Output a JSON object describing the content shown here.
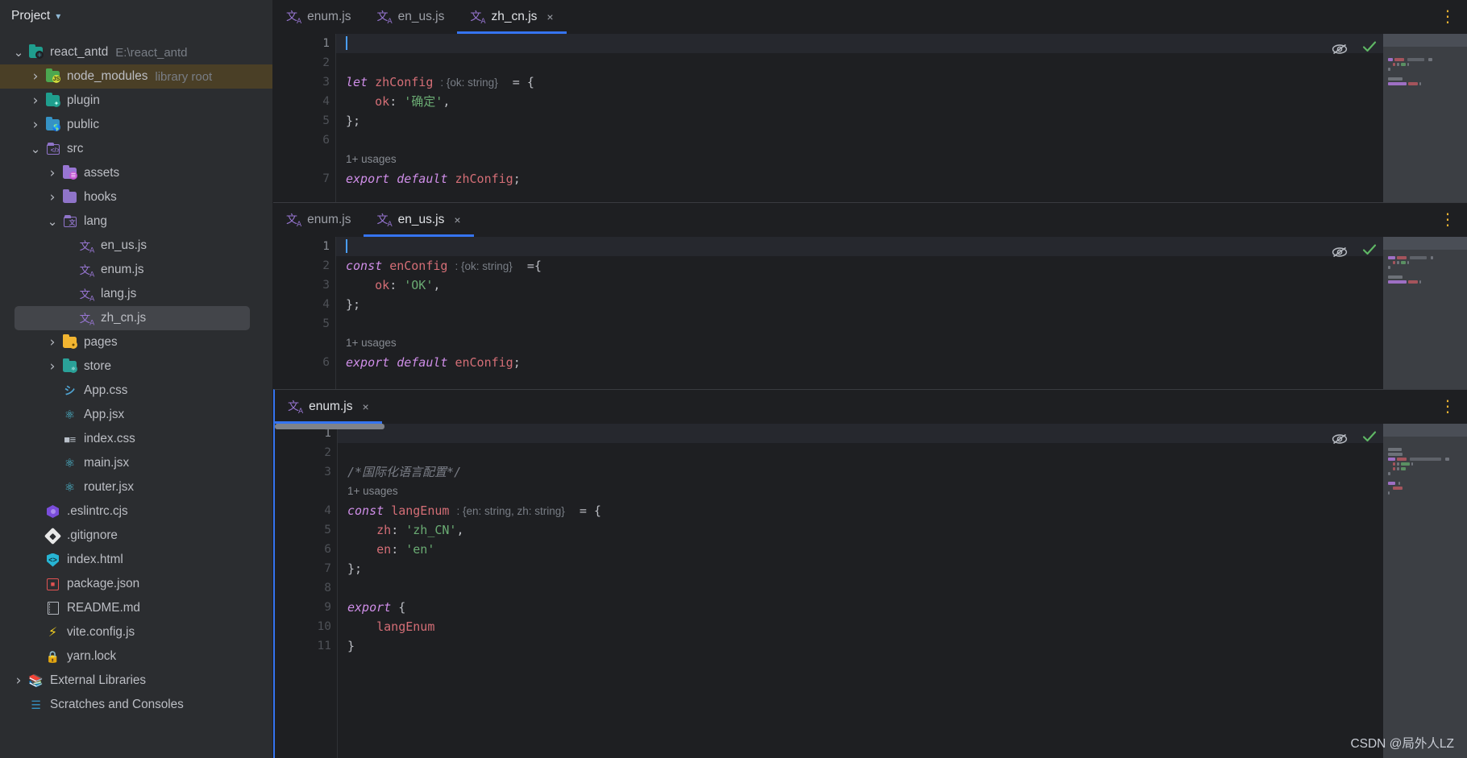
{
  "sidebar": {
    "title": "Project",
    "title_chevron": "chevron-down-icon",
    "tree": [
      {
        "label": "react_antd",
        "hint": "E:\\react_antd",
        "arrow": "v",
        "icon": "module-icon",
        "depth": 0,
        "state": "normal"
      },
      {
        "label": "node_modules",
        "hint": "library root",
        "arrow": ">",
        "icon": "folder-node-icon",
        "depth": 1,
        "state": "library-highlight"
      },
      {
        "label": "plugin",
        "hint": "",
        "arrow": ">",
        "icon": "folder-plugin-icon",
        "depth": 1,
        "state": "normal"
      },
      {
        "label": "public",
        "hint": "",
        "arrow": ">",
        "icon": "folder-public-icon",
        "depth": 1,
        "state": "normal"
      },
      {
        "label": "src",
        "hint": "",
        "arrow": "v",
        "icon": "folder-source-icon",
        "depth": 1,
        "state": "normal"
      },
      {
        "label": "assets",
        "hint": "",
        "arrow": ">",
        "icon": "folder-assets-icon",
        "depth": 2,
        "state": "normal"
      },
      {
        "label": "hooks",
        "hint": "",
        "arrow": ">",
        "icon": "folder-hooks-icon",
        "depth": 2,
        "state": "normal"
      },
      {
        "label": "lang",
        "hint": "",
        "arrow": "v",
        "icon": "folder-lang-icon",
        "depth": 2,
        "state": "normal"
      },
      {
        "label": "en_us.js",
        "hint": "",
        "arrow": "",
        "icon": "translation-file-icon",
        "depth": 3,
        "state": "normal"
      },
      {
        "label": "enum.js",
        "hint": "",
        "arrow": "",
        "icon": "translation-file-icon",
        "depth": 3,
        "state": "normal"
      },
      {
        "label": "lang.js",
        "hint": "",
        "arrow": "",
        "icon": "translation-file-icon",
        "depth": 3,
        "state": "normal"
      },
      {
        "label": "zh_cn.js",
        "hint": "",
        "arrow": "",
        "icon": "translation-file-icon",
        "depth": 3,
        "state": "selected"
      },
      {
        "label": "pages",
        "hint": "",
        "arrow": ">",
        "icon": "folder-pages-icon",
        "depth": 2,
        "state": "normal"
      },
      {
        "label": "store",
        "hint": "",
        "arrow": ">",
        "icon": "folder-store-icon",
        "depth": 2,
        "state": "normal"
      },
      {
        "label": "App.css",
        "hint": "",
        "arrow": "",
        "icon": "css-file-icon",
        "depth": 2,
        "state": "normal"
      },
      {
        "label": "App.jsx",
        "hint": "",
        "arrow": "",
        "icon": "react-file-icon",
        "depth": 2,
        "state": "normal"
      },
      {
        "label": "index.css",
        "hint": "",
        "arrow": "",
        "icon": "css-list-icon",
        "depth": 2,
        "state": "normal"
      },
      {
        "label": "main.jsx",
        "hint": "",
        "arrow": "",
        "icon": "react-file-icon",
        "depth": 2,
        "state": "normal"
      },
      {
        "label": "router.jsx",
        "hint": "",
        "arrow": "",
        "icon": "react-file-icon",
        "depth": 2,
        "state": "normal"
      },
      {
        "label": ".eslintrc.cjs",
        "hint": "",
        "arrow": "",
        "icon": "eslint-file-icon",
        "depth": 1,
        "state": "normal"
      },
      {
        "label": ".gitignore",
        "hint": "",
        "arrow": "",
        "icon": "git-file-icon",
        "depth": 1,
        "state": "normal"
      },
      {
        "label": "index.html",
        "hint": "",
        "arrow": "",
        "icon": "html-file-icon",
        "depth": 1,
        "state": "normal"
      },
      {
        "label": "package.json",
        "hint": "",
        "arrow": "",
        "icon": "npm-file-icon",
        "depth": 1,
        "state": "normal"
      },
      {
        "label": "README.md",
        "hint": "",
        "arrow": "",
        "icon": "markdown-file-icon",
        "depth": 1,
        "state": "normal"
      },
      {
        "label": "vite.config.js",
        "hint": "",
        "arrow": "",
        "icon": "vite-file-icon",
        "depth": 1,
        "state": "normal"
      },
      {
        "label": "yarn.lock",
        "hint": "",
        "arrow": "",
        "icon": "lock-file-icon",
        "depth": 1,
        "state": "normal"
      },
      {
        "label": "External Libraries",
        "hint": "",
        "arrow": ">",
        "icon": "external-libraries-icon",
        "depth": 0,
        "state": "normal"
      },
      {
        "label": "Scratches and Consoles",
        "hint": "",
        "arrow": "",
        "icon": "scratches-icon",
        "depth": 0,
        "state": "normal"
      }
    ]
  },
  "editors": [
    {
      "id": "pane-zh-cn",
      "tabs": [
        {
          "label": "enum.js",
          "active": false,
          "closable": false
        },
        {
          "label": "en_us.js",
          "active": false,
          "closable": false
        },
        {
          "label": "zh_cn.js",
          "active": true,
          "closable": true
        }
      ],
      "tab_menu_icon": "more-vertical-icon",
      "inspection": {
        "eye_icon": "eye-off-icon",
        "status_icon": "check-icon"
      },
      "lines": [
        {
          "num": "1",
          "fold": "",
          "cursor": true,
          "tokens": []
        },
        {
          "num": "2",
          "fold": "",
          "tokens": []
        },
        {
          "num": "3",
          "fold": "v",
          "tokens": [
            {
              "t": "kw",
              "v": "let "
            },
            {
              "t": "id",
              "v": "zhConfig"
            },
            {
              "t": "punc",
              "v": " "
            },
            {
              "t": "type",
              "v": ": {ok: string}"
            },
            {
              "t": "punc",
              "v": "  = {"
            }
          ]
        },
        {
          "num": "4",
          "fold": "",
          "tokens": [
            {
              "t": "punc",
              "v": "    "
            },
            {
              "t": "prop",
              "v": "ok"
            },
            {
              "t": "punc",
              "v": ": "
            },
            {
              "t": "str",
              "v": "'确定'"
            },
            {
              "t": "punc",
              "v": ","
            }
          ]
        },
        {
          "num": "5",
          "fold": "",
          "tokens": [
            {
              "t": "punc",
              "v": "};"
            }
          ]
        },
        {
          "num": "6",
          "fold": "",
          "tokens": []
        },
        {
          "num": "",
          "fold": "",
          "usage": "1+ usages"
        },
        {
          "num": "7",
          "fold": "",
          "tokens": [
            {
              "t": "kw",
              "v": "export default "
            },
            {
              "t": "id",
              "v": "zhConfig"
            },
            {
              "t": "punc",
              "v": ";"
            }
          ]
        }
      ]
    },
    {
      "id": "pane-en-us",
      "tabs": [
        {
          "label": "enum.js",
          "active": false,
          "closable": false
        },
        {
          "label": "en_us.js",
          "active": true,
          "closable": true
        }
      ],
      "tab_menu_icon": "more-vertical-icon",
      "inspection": {
        "eye_icon": "eye-off-icon",
        "status_icon": "check-icon"
      },
      "lines": [
        {
          "num": "1",
          "fold": "",
          "cursor": true,
          "tokens": []
        },
        {
          "num": "2",
          "fold": "",
          "tokens": [
            {
              "t": "kw",
              "v": "const "
            },
            {
              "t": "id",
              "v": "enConfig"
            },
            {
              "t": "punc",
              "v": " "
            },
            {
              "t": "type",
              "v": ": {ok: string}"
            },
            {
              "t": "punc",
              "v": "  ={"
            }
          ]
        },
        {
          "num": "3",
          "fold": "",
          "tokens": [
            {
              "t": "punc",
              "v": "    "
            },
            {
              "t": "prop",
              "v": "ok"
            },
            {
              "t": "punc",
              "v": ": "
            },
            {
              "t": "str",
              "v": "'OK'"
            },
            {
              "t": "punc",
              "v": ","
            }
          ]
        },
        {
          "num": "4",
          "fold": "",
          "tokens": [
            {
              "t": "punc",
              "v": "};"
            }
          ]
        },
        {
          "num": "5",
          "fold": "",
          "tokens": []
        },
        {
          "num": "",
          "fold": "",
          "usage": "1+ usages"
        },
        {
          "num": "6",
          "fold": "",
          "tokens": [
            {
              "t": "kw",
              "v": "export default "
            },
            {
              "t": "id",
              "v": "enConfig"
            },
            {
              "t": "punc",
              "v": ";"
            }
          ]
        }
      ]
    },
    {
      "id": "pane-enum",
      "tabs": [
        {
          "label": "enum.js",
          "active": true,
          "closable": true
        }
      ],
      "tab_menu_icon": "more-vertical-icon",
      "inspection": {
        "eye_icon": "eye-off-icon",
        "status_icon": "check-icon"
      },
      "has_hscrollbar": true,
      "lines": [
        {
          "num": "1",
          "fold": "",
          "current": true,
          "tokens": []
        },
        {
          "num": "2",
          "fold": "",
          "tokens": []
        },
        {
          "num": "3",
          "fold": "",
          "tokens": [
            {
              "t": "cmt",
              "v": "/*国际化语言配置*/"
            }
          ]
        },
        {
          "num": "",
          "fold": "",
          "usage": "1+ usages"
        },
        {
          "num": "4",
          "fold": "v",
          "tokens": [
            {
              "t": "kw",
              "v": "const "
            },
            {
              "t": "id",
              "v": "langEnum"
            },
            {
              "t": "punc",
              "v": " "
            },
            {
              "t": "type",
              "v": ": {en: string, zh: string}"
            },
            {
              "t": "punc",
              "v": "  = {"
            }
          ]
        },
        {
          "num": "5",
          "fold": "",
          "tokens": [
            {
              "t": "punc",
              "v": "    "
            },
            {
              "t": "prop",
              "v": "zh"
            },
            {
              "t": "punc",
              "v": ": "
            },
            {
              "t": "str",
              "v": "'zh_CN'"
            },
            {
              "t": "punc",
              "v": ","
            }
          ]
        },
        {
          "num": "6",
          "fold": "",
          "tokens": [
            {
              "t": "punc",
              "v": "    "
            },
            {
              "t": "prop",
              "v": "en"
            },
            {
              "t": "punc",
              "v": ": "
            },
            {
              "t": "str",
              "v": "'en'"
            }
          ]
        },
        {
          "num": "7",
          "fold": "",
          "tokens": [
            {
              "t": "punc",
              "v": "};"
            }
          ]
        },
        {
          "num": "8",
          "fold": "",
          "tokens": []
        },
        {
          "num": "9",
          "fold": "",
          "tokens": [
            {
              "t": "kw",
              "v": "export"
            },
            {
              "t": "punc",
              "v": " {"
            }
          ]
        },
        {
          "num": "10",
          "fold": "",
          "tokens": [
            {
              "t": "punc",
              "v": "    "
            },
            {
              "t": "id",
              "v": "langEnum"
            }
          ]
        },
        {
          "num": "11",
          "fold": "",
          "tokens": [
            {
              "t": "punc",
              "v": "}"
            }
          ]
        }
      ]
    }
  ],
  "watermark": "CSDN @局外人LZ",
  "colors": {
    "accent": "#3574f0",
    "sidebar_bg": "#2b2d30",
    "editor_bg": "#1e1f22",
    "selection": "#43454a",
    "library_highlight": "#4a3f26",
    "string": "#6aab73",
    "keyword": "#cf8ee8",
    "identifier": "#d46e76",
    "comment": "#7a7e87",
    "ok_check": "#5fb865"
  }
}
